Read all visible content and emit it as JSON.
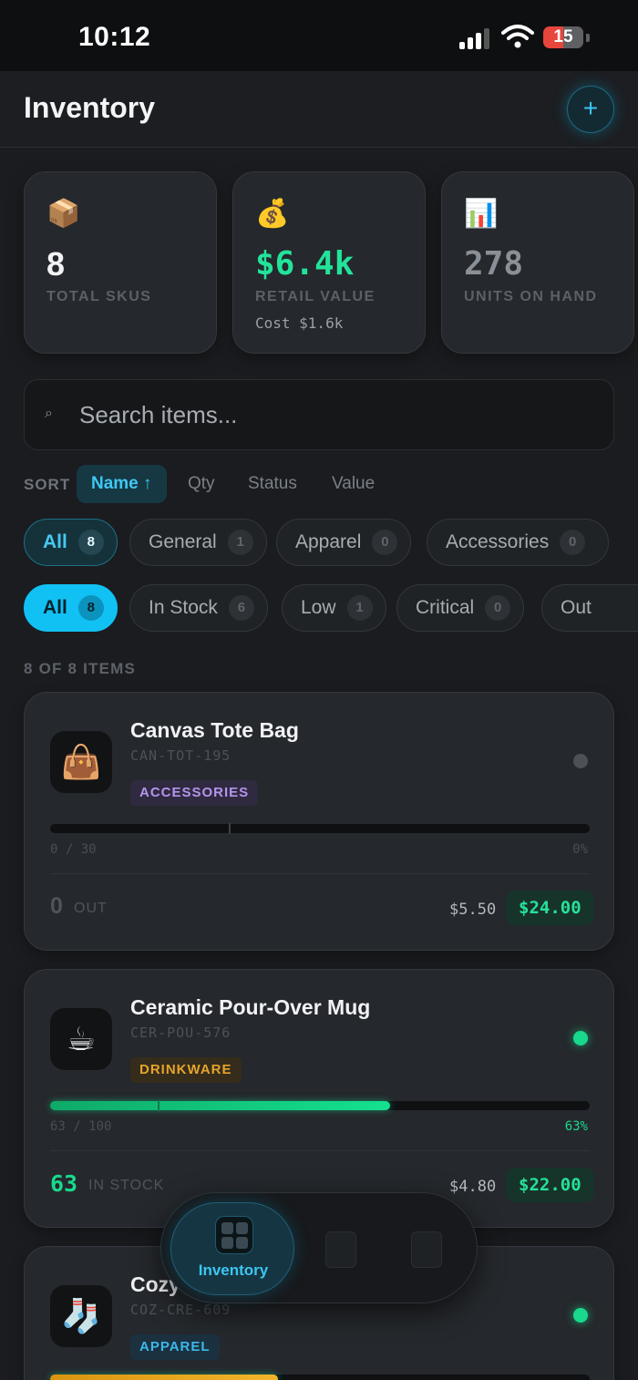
{
  "status_bar": {
    "time": "10:12",
    "battery": "15"
  },
  "header": {
    "title": "Inventory",
    "add_label": "+"
  },
  "stats": [
    {
      "icon": "📦",
      "value": "8",
      "label": "TOTAL SKUS",
      "color": "#f2f3f5"
    },
    {
      "icon": "💰",
      "value": "$6.4k",
      "label": "RETAIL VALUE",
      "sub": "Cost $1.6k",
      "color": "#22e39a"
    },
    {
      "icon": "📊",
      "value": "278",
      "label": "UNITS ON HAND",
      "color": "#8a9097"
    }
  ],
  "search": {
    "placeholder": "Search items..."
  },
  "sort": {
    "label": "SORT",
    "options": [
      "Name ↑",
      "Qty",
      "Status",
      "Value"
    ]
  },
  "category_filters": [
    {
      "label": "All",
      "count": "8"
    },
    {
      "label": "General",
      "count": "1"
    },
    {
      "label": "Apparel",
      "count": "0"
    },
    {
      "label": "Accessories",
      "count": "0"
    }
  ],
  "status_filters": [
    {
      "label": "All",
      "count": "8"
    },
    {
      "label": "In Stock",
      "count": "6"
    },
    {
      "label": "Low",
      "count": "1"
    },
    {
      "label": "Critical",
      "count": "0"
    },
    {
      "label": "Out",
      "count": ""
    }
  ],
  "items_count": "8 OF 8 ITEMS",
  "items": [
    {
      "icon": "👜",
      "name": "Canvas Tote Bag",
      "sku": "CAN-TOT-195",
      "category": "ACCESSORIES",
      "stock_text": "0 / 30",
      "percent_text": "0%",
      "fill": 0,
      "qty": "0",
      "status": "OUT",
      "cost": "$5.50",
      "price": "$24.00"
    },
    {
      "icon": "☕",
      "name": "Ceramic Pour-Over Mug",
      "sku": "CER-POU-576",
      "category": "DRINKWARE",
      "stock_text": "63 / 100",
      "percent_text": "63%",
      "fill": 0.63,
      "qty": "63",
      "status": "IN STOCK",
      "cost": "$4.80",
      "price": "$22.00"
    },
    {
      "icon": "🧦",
      "name": "Cozy",
      "sku": "COZ-CRE-609",
      "category": "APPAREL"
    }
  ],
  "nav": {
    "active_label": "Inventory"
  }
}
